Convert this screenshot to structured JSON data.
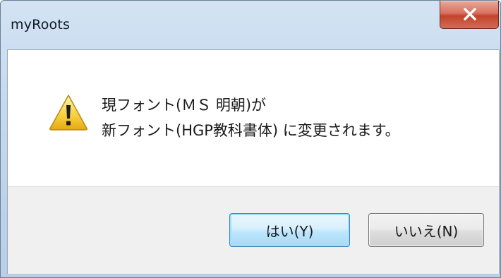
{
  "window": {
    "title": "myRoots"
  },
  "message": {
    "line1": "現フォント(ＭＳ 明朝)が",
    "line2": "新フォント(HGP教科書体) に変更されます。"
  },
  "icons": {
    "dialog_icon": "warning-icon",
    "close": "close-icon"
  },
  "buttons": {
    "yes_label": "はい(Y)",
    "no_label": "いいえ(N)"
  },
  "colors": {
    "close_button": "#c2432c",
    "default_button_border": "#3c7fb1",
    "footer_bg": "#f0f0f0"
  }
}
